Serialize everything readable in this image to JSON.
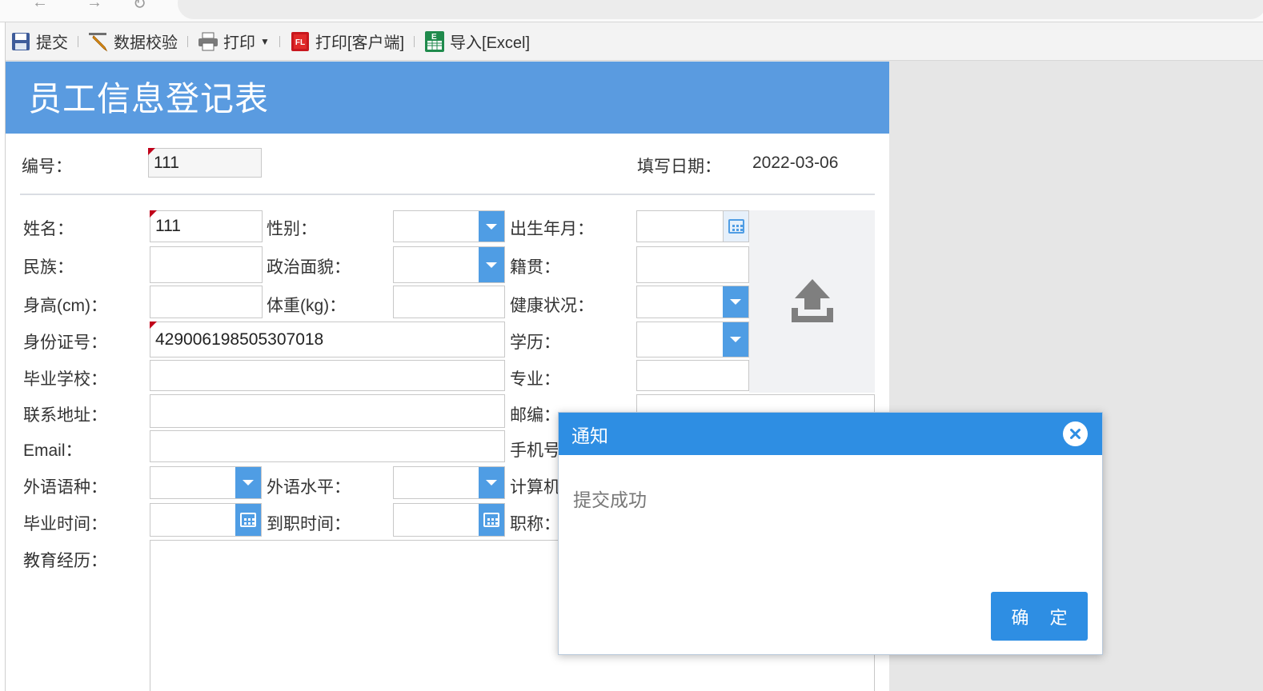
{
  "toolbar": {
    "submit": "提交",
    "validate": "数据校验",
    "print": "打印",
    "print_client": "打印[客户端]",
    "import_excel": "导入[Excel]",
    "pdf_badge": "FL",
    "excel_badge": "E"
  },
  "form": {
    "title": "员工信息登记表",
    "id_label": "编号：",
    "id_value": "111",
    "date_label": "填写日期：",
    "date_value": "2022-03-06",
    "name_label": "姓名：",
    "name_value": "111",
    "gender_label": "性别：",
    "birth_label": "出生年月：",
    "ethnicity_label": "民族：",
    "political_label": "政治面貌：",
    "native_label": "籍贯：",
    "height_label": "身高(cm)：",
    "weight_label": "体重(kg)：",
    "health_label": "健康状况：",
    "idcard_label": "身份证号：",
    "idcard_value": "429006198505307018",
    "education_label": "学历：",
    "school_label": "毕业学校：",
    "major_label": "专业：",
    "address_label": "联系地址：",
    "postcode_label": "邮编：",
    "email_label": "Email：",
    "phone_label": "手机号",
    "language_label": "外语语种：",
    "language_level_label": "外语水平：",
    "computer_label": "计算机",
    "graduation_label": "毕业时间：",
    "join_label": "到职时间：",
    "title_label": "职称：",
    "edu_history_label": "教育经历："
  },
  "dialog": {
    "title": "通知",
    "message": "提交成功",
    "ok_label": "确 定"
  },
  "colors": {
    "header_blue": "#5a9be0",
    "dialog_blue": "#2e8ee3",
    "button_blue": "#4f9de4",
    "required_marker": "#c0001a"
  },
  "icons": [
    "save-icon",
    "pencil-icon",
    "printer-icon",
    "pdf-icon",
    "excel-icon",
    "upload-icon",
    "calendar-icon",
    "chevron-down-icon",
    "close-icon"
  ]
}
